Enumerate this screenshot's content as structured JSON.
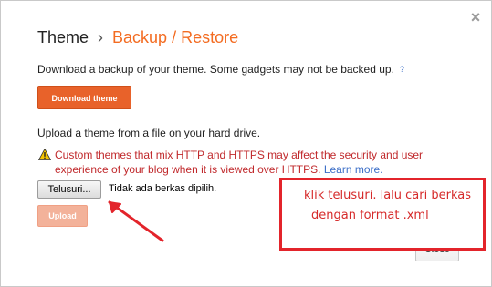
{
  "breadcrumb": {
    "root": "Theme",
    "separator": "›",
    "current": "Backup / Restore"
  },
  "close_icon": "×",
  "download": {
    "description": "Download a backup of your theme. Some gadgets may not be backed up.",
    "help": "?",
    "button": "Download theme"
  },
  "upload": {
    "description": "Upload a theme from a file on your hard drive.",
    "warning": "Custom themes that mix HTTP and HTTPS may affect the security and user experience of your blog when it is viewed over HTTPS.",
    "learn_more": "Learn more.",
    "browse_button": "Telusuri...",
    "file_status": "Tidak ada berkas dipilih.",
    "upload_button": "Upload"
  },
  "annotation": {
    "line1": "klik telusuri. lalu cari berkas",
    "line2": "dengan format .xml"
  },
  "footer": {
    "close_button": "Close"
  },
  "colors": {
    "accent": "#f36c22",
    "button_orange": "#e8622a",
    "warning_red": "#c0282b",
    "link_blue": "#3b6ec7",
    "annotation_red": "#e3242b"
  },
  "icons": {
    "warning": "warning-triangle-icon",
    "close": "close-icon",
    "help": "help-icon"
  }
}
